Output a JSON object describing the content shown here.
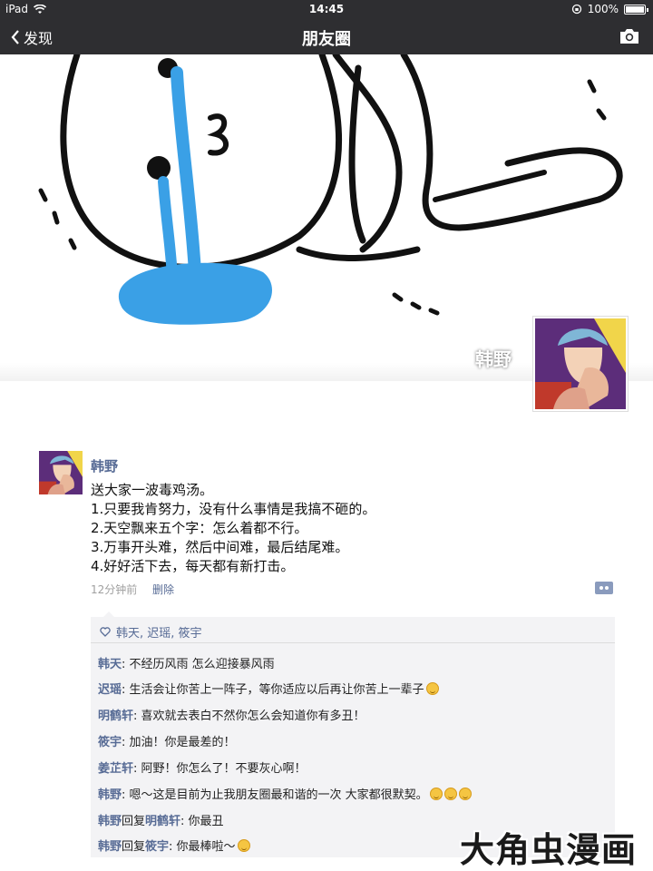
{
  "status_bar": {
    "device": "iPad",
    "time": "14:45",
    "battery": "100%",
    "battery_level": 1.0
  },
  "nav": {
    "back_label": "发现",
    "title": "朋友圈"
  },
  "cover": {
    "owner_name": "韩野"
  },
  "post": {
    "author": "韩野",
    "lines": [
      "送大家一波毒鸡汤。",
      "1.只要我肯努力，没有什么事情是我搞不砸的。",
      "2.天空飘来五个字：怎么着都不行。",
      "3.万事开头难，然后中间难，最后结尾难。",
      "4.好好活下去，每天都有新打击。"
    ],
    "time": "12分钟前",
    "delete_label": "删除"
  },
  "likes": "韩天, 迟瑶, 筱宇",
  "comments": [
    {
      "name": "韩天",
      "text": ": 不经历风雨 怎么迎接暴风雨",
      "emoji": 0
    },
    {
      "name": "迟瑶",
      "text": ": 生活会让你苦上一阵子，等你适应以后再让你苦上一辈子",
      "emoji": 1
    },
    {
      "name": "明鹤轩",
      "text": ": 喜欢就去表白不然你怎么会知道你有多丑！",
      "emoji": 0
    },
    {
      "name": "筱宇",
      "text": ": 加油！你是最差的！",
      "emoji": 0
    },
    {
      "name": "姜芷轩",
      "text": ": 阿野！你怎么了！不要灰心啊！",
      "emoji": 0
    },
    {
      "name": "韩野",
      "text": ": 嗯～这是目前为止我朋友圈最和谐的一次 大家都很默契。",
      "emoji": 3
    },
    {
      "name": "韩野",
      "reply_word": "回复",
      "target": "明鹤轩",
      "text": ": 你最丑",
      "emoji": 0
    },
    {
      "name": "韩野",
      "reply_word": "回复",
      "target": "筱宇",
      "text": ": 你最棒啦～",
      "emoji": 1
    }
  ],
  "watermark": "大角虫漫画",
  "colors": {
    "link": "#576b95",
    "navbar": "#2e2e31",
    "tear": "#3aa0e6"
  }
}
